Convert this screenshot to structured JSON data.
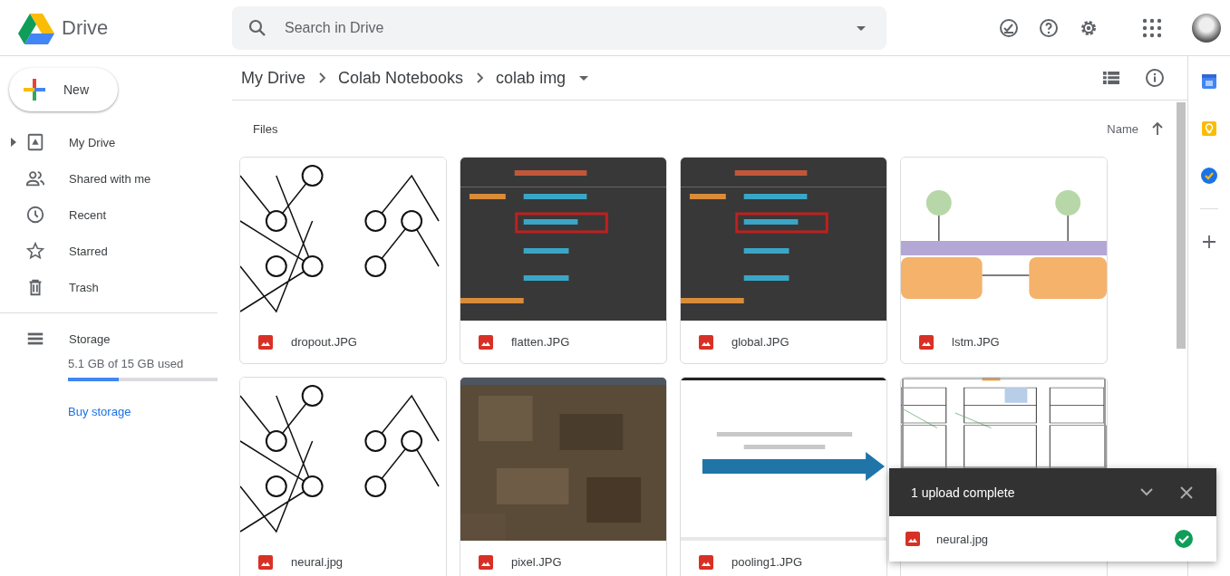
{
  "app": {
    "name": "Drive"
  },
  "search": {
    "placeholder": "Search in Drive"
  },
  "new_button": {
    "label": "New"
  },
  "sidebar": {
    "items": [
      {
        "label": "My Drive",
        "selected": false,
        "expanded": false
      },
      {
        "label": "Shared with me",
        "selected": false
      },
      {
        "label": "Recent",
        "selected": false
      },
      {
        "label": "Starred",
        "selected": false
      },
      {
        "label": "Trash",
        "selected": false
      }
    ],
    "storage": {
      "label": "Storage",
      "usage": "5.1 GB of 15 GB used",
      "level": 0.34,
      "link": "Buy storage"
    }
  },
  "breadcrumb": [
    "My Drive",
    "Colab Notebooks",
    "colab img"
  ],
  "section_title": "Files",
  "sort": {
    "label": "Name"
  },
  "files": [
    {
      "name": "dropout.JPG",
      "kind": "picture"
    },
    {
      "name": "flatten.JPG",
      "kind": "picture"
    },
    {
      "name": "global.JPG",
      "kind": "picture"
    },
    {
      "name": "lstm.JPG",
      "kind": "picture"
    },
    {
      "name": "neural.jpg",
      "kind": "picture"
    },
    {
      "name": "pixel.JPG",
      "kind": "picture"
    },
    {
      "name": "pooling1.JPG",
      "kind": "picture"
    },
    {
      "kind": "picture"
    }
  ],
  "upload_panel": {
    "title": "1 upload complete",
    "items": [
      {
        "name": "neural.jpg",
        "done": true
      }
    ]
  }
}
